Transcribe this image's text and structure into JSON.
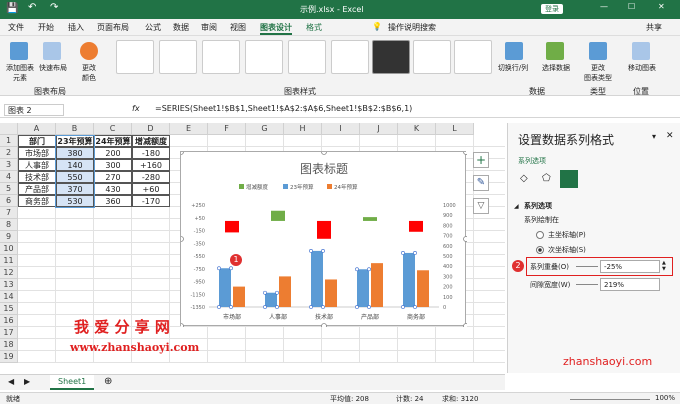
{
  "title": {
    "file": "示例.xlsx - Excel",
    "login": "登录"
  },
  "tabs": [
    "文件",
    "开始",
    "插入",
    "页面布局",
    "公式",
    "数据",
    "审阅",
    "视图",
    "图表设计",
    "格式"
  ],
  "tell_me": "操作说明搜索",
  "share": "共享",
  "ribbon": {
    "add_element": "添加图表\n元素",
    "quick_layout": "快速布局",
    "change_color": "更改\n颜色",
    "switch_rowcol": "切换行/列",
    "select_data": "选择数据",
    "change_type": "更改\n图表类型",
    "move_chart": "移动图表",
    "group_layout": "图表布局",
    "group_styles": "图表样式",
    "group_data": "数据",
    "group_type": "类型",
    "group_pos": "位置"
  },
  "formula_bar": {
    "name_box": "图表 2",
    "fx": "fx",
    "formula": "=SERIES(Sheet1!$B$1,Sheet1!$A$2:$A$6,Sheet1!$B$2:$B$6,1)"
  },
  "columns": [
    "A",
    "B",
    "C",
    "D",
    "E",
    "F",
    "G",
    "H",
    "I",
    "J",
    "K",
    "L"
  ],
  "rows": [
    "1",
    "2",
    "3",
    "4",
    "5",
    "6",
    "7",
    "8",
    "9",
    "10",
    "11",
    "12",
    "13",
    "14",
    "15",
    "16",
    "17",
    "18",
    "19"
  ],
  "table": {
    "headers": [
      "部门",
      "23年预算",
      "24年预算",
      "增减额度"
    ],
    "rows": [
      [
        "市场部",
        "380",
        "200",
        "-180"
      ],
      [
        "人事部",
        "140",
        "300",
        "+160"
      ],
      [
        "技术部",
        "550",
        "270",
        "-280"
      ],
      [
        "产品部",
        "370",
        "430",
        "+60"
      ],
      [
        "商务部",
        "530",
        "360",
        "-170"
      ]
    ]
  },
  "chart_data": {
    "type": "bar",
    "title": "图表标题",
    "categories": [
      "市场部",
      "人事部",
      "技术部",
      "产品部",
      "商务部"
    ],
    "series": [
      {
        "name": "增减额度",
        "values": [
          -180,
          160,
          -280,
          60,
          -170
        ],
        "color": "#70ad47"
      },
      {
        "name": "23年预算",
        "values": [
          380,
          140,
          550,
          370,
          530
        ],
        "color": "#5b9bd5"
      },
      {
        "name": "24年预算",
        "values": [
          200,
          300,
          270,
          430,
          360
        ],
        "color": "#ed7d31"
      }
    ],
    "left_axis": [
      "+250",
      "+50",
      "-150",
      "-350",
      "-550",
      "-750",
      "-950",
      "-1150",
      "-1350"
    ],
    "right_axis": [
      "1000",
      "900",
      "800",
      "700",
      "600",
      "500",
      "400",
      "300",
      "200",
      "100",
      "0"
    ]
  },
  "badges": [
    "1",
    "2"
  ],
  "panel": {
    "title": "设置数据系列格式",
    "options_label": "系列选项",
    "section": "系列选项",
    "draw_on": "系列绘制在",
    "primary": "主坐标轴(P)",
    "secondary": "次坐标轴(S)",
    "overlap_label": "系列重叠(O)",
    "overlap_value": "-25%",
    "gap_label": "间隙宽度(W)",
    "gap_value": "219%"
  },
  "sheet_tab": "Sheet1",
  "status": {
    "ready": "就绪",
    "avg": "平均值: 208",
    "count": "计数: 24",
    "sum": "求和: 3120",
    "zoom": "100%"
  },
  "watermark": {
    "cn": "我 爱 分 享 网",
    "url": "www.zhanshaoyi.com",
    "url2": "zhanshaoyi.com"
  }
}
